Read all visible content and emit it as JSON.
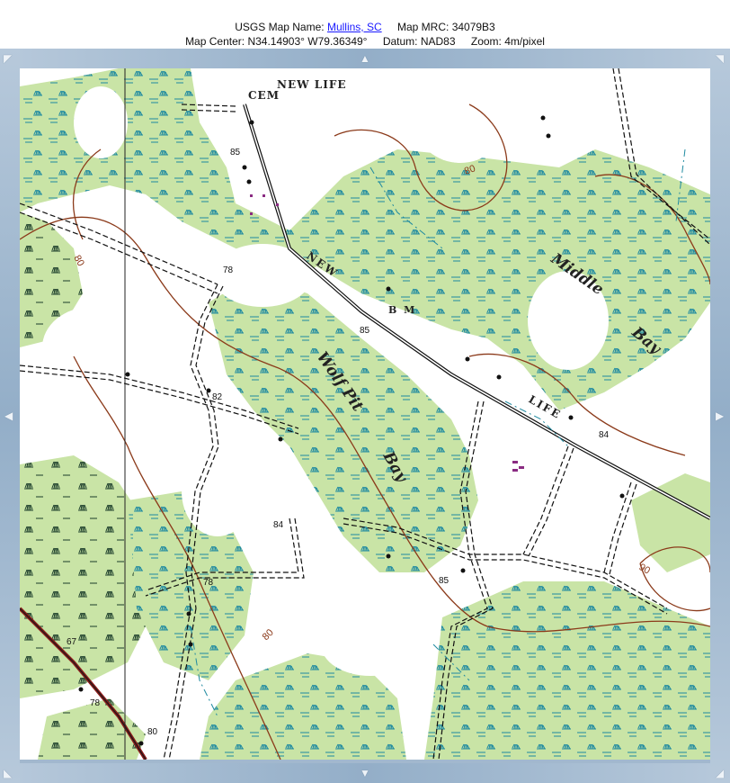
{
  "header": {
    "map_name_label": "USGS Map Name:",
    "map_name_link": "Mullins, SC",
    "map_mrc_label": "Map MRC:",
    "map_mrc_value": "34079B3",
    "map_center_label": "Map Center:",
    "map_center_value": "N34.14903°  W79.36349°",
    "datum_label": "Datum:",
    "datum_value": "NAD83",
    "zoom_label": "Zoom:",
    "zoom_value": "4m/pixel"
  },
  "pan_controls": {
    "up": "▲",
    "down": "▼",
    "left": "◀",
    "right": "▶",
    "nw": "◤",
    "ne": "◥",
    "sw": "◣",
    "se": "◢"
  },
  "map": {
    "labels": {
      "cemetery_1": "NEW LIFE",
      "cemetery_2": "CEM",
      "road_new": "NEW",
      "road_life": "LIFE",
      "bm": "B M",
      "middle": "Middle",
      "bay1": "Bay",
      "wolf_pit": "Wolf Pit",
      "bay2": "Bay"
    },
    "spot_elevations": [
      "85",
      "78",
      "82",
      "84",
      "78",
      "67",
      "78",
      "80",
      "85",
      "84",
      "85"
    ],
    "contour_labels": [
      "80",
      "80",
      "80",
      "90"
    ]
  },
  "colors": {
    "swamp_green": "#c9e4a6",
    "marsh_blue": "#1f8aa0",
    "contour_brown": "#8b3a1a",
    "road_black": "#111111",
    "frame_blue": "#9fb6cd",
    "link_blue": "#1a1aff"
  }
}
